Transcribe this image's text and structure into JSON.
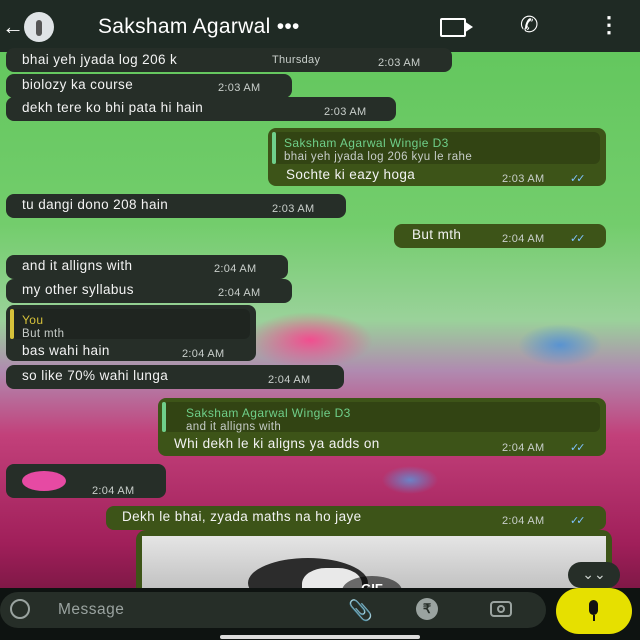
{
  "header": {
    "contact_name": "Saksham Agarwal",
    "more_indicator": "•••"
  },
  "icons": {
    "back": "←",
    "call": "✆",
    "menu": "⋮",
    "attach": "📎",
    "rupee": "₹",
    "scroll_down": "⌄⌄"
  },
  "messages": [
    {
      "id": "m1",
      "dir": "in",
      "text": "bhai yeh jyada log 206 k",
      "overlay": "Thursday",
      "time": "2:03 AM"
    },
    {
      "id": "m2",
      "dir": "in",
      "text": "biolozy ka course",
      "time": "2:03 AM"
    },
    {
      "id": "m3",
      "dir": "in",
      "text": "dekh tere ko bhi pata hi hain",
      "time": "2:03 AM"
    },
    {
      "id": "m4",
      "dir": "out",
      "quote_name": "Saksham Agarwal Wingie D3",
      "quote_text": "bhai yeh jyada log 206 kyu le rahe",
      "text": "Sochte ki eazy hoga",
      "time": "2:03 AM",
      "ticks": "✓✓"
    },
    {
      "id": "m5",
      "dir": "in",
      "text": "tu dangi dono 208 hain",
      "time": "2:03 AM"
    },
    {
      "id": "m6",
      "dir": "out",
      "text": "But mth",
      "time": "2:04 AM",
      "ticks": "✓✓"
    },
    {
      "id": "m7",
      "dir": "in",
      "text": "and it alligns with",
      "time": "2:04 AM"
    },
    {
      "id": "m8",
      "dir": "in",
      "text": "my other syllabus",
      "time": "2:04 AM"
    },
    {
      "id": "m9",
      "dir": "in",
      "quote_name": "You",
      "quote_text": "But mth",
      "text": "bas wahi hain",
      "time": "2:04 AM"
    },
    {
      "id": "m10",
      "dir": "in",
      "text": "so like 70% wahi lunga",
      "time": "2:04 AM"
    },
    {
      "id": "m11",
      "dir": "out",
      "quote_name": "Saksham Agarwal Wingie D3",
      "quote_text": "and it alligns with",
      "text": "Whi dekh le ki aligns ya adds on",
      "time": "2:04 AM",
      "ticks": "✓✓"
    },
    {
      "id": "m12",
      "dir": "in",
      "text": "",
      "time": "2:04 AM"
    },
    {
      "id": "m13",
      "dir": "out",
      "text": "Dekh le bhai, zyada maths na ho jaye",
      "time": "2:04 AM",
      "ticks": "✓✓"
    }
  ],
  "media_preview": {
    "badge": "GIF"
  },
  "composer": {
    "placeholder": "Message"
  },
  "colors": {
    "incoming_bubble": "#262e28",
    "outgoing_bubble": "#3d5418",
    "quote_name_other": "#6fcf8a",
    "quote_name_you": "#d6c13a",
    "read_ticks": "#7fc3ff",
    "mic_button": "#e6e000"
  }
}
